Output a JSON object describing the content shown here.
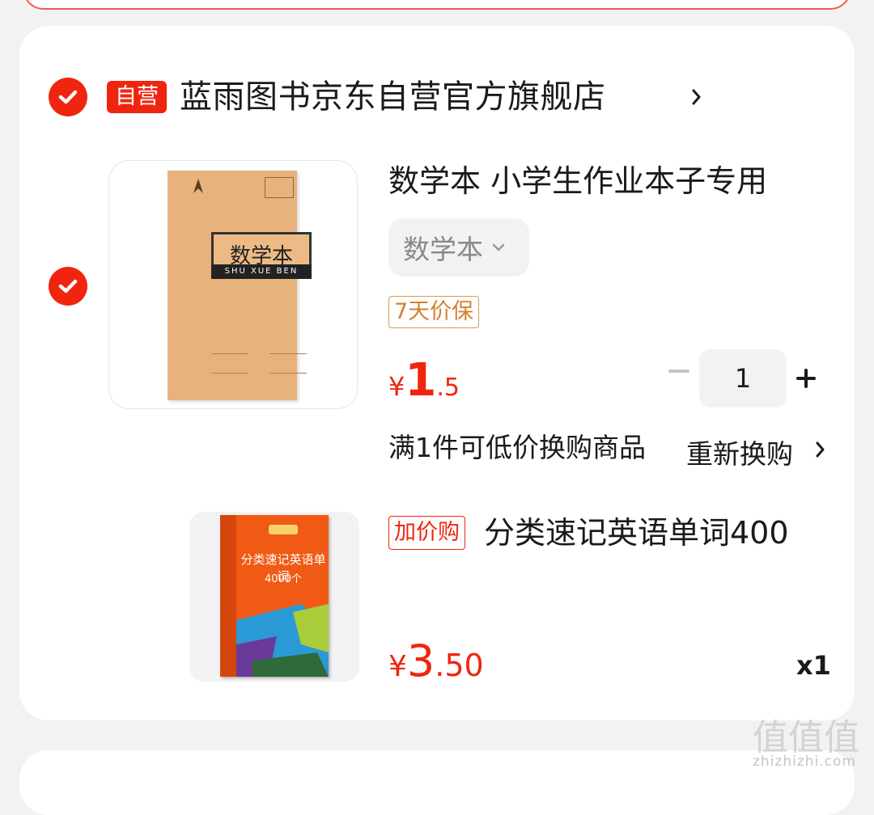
{
  "shop": {
    "badge": "自营",
    "name": "蓝雨图书京东自营官方旗舰店"
  },
  "product": {
    "title": "数学本 小学生作业本子专用",
    "variant": "数学本",
    "service_tag": "7天价保",
    "price_currency": "¥",
    "price_int": "1",
    "price_dec": ".5",
    "quantity": "1",
    "cover_title": "数学本",
    "cover_subtitle": "SHU  XUE  BEN"
  },
  "promo": {
    "text": "满1件可低价换购商品",
    "action": "重新换购"
  },
  "addon": {
    "tag": "加价购",
    "title": "分类速记英语单词400",
    "price_currency": "¥",
    "price_int": "3",
    "price_dec": ".50",
    "quantity": "x1",
    "cover_title": "分类速记英语单词",
    "cover_sub": "4000个"
  },
  "watermark": {
    "logo": "值值值",
    "text": "zhizhizhi.com"
  },
  "colors": {
    "accent": "#f0250f",
    "price_guard": "#d4802e",
    "background": "#f2f2f2"
  },
  "icons": [
    "check-circle-icon",
    "chevron-right-icon",
    "chevron-down-icon",
    "minus-icon",
    "plus-icon"
  ]
}
